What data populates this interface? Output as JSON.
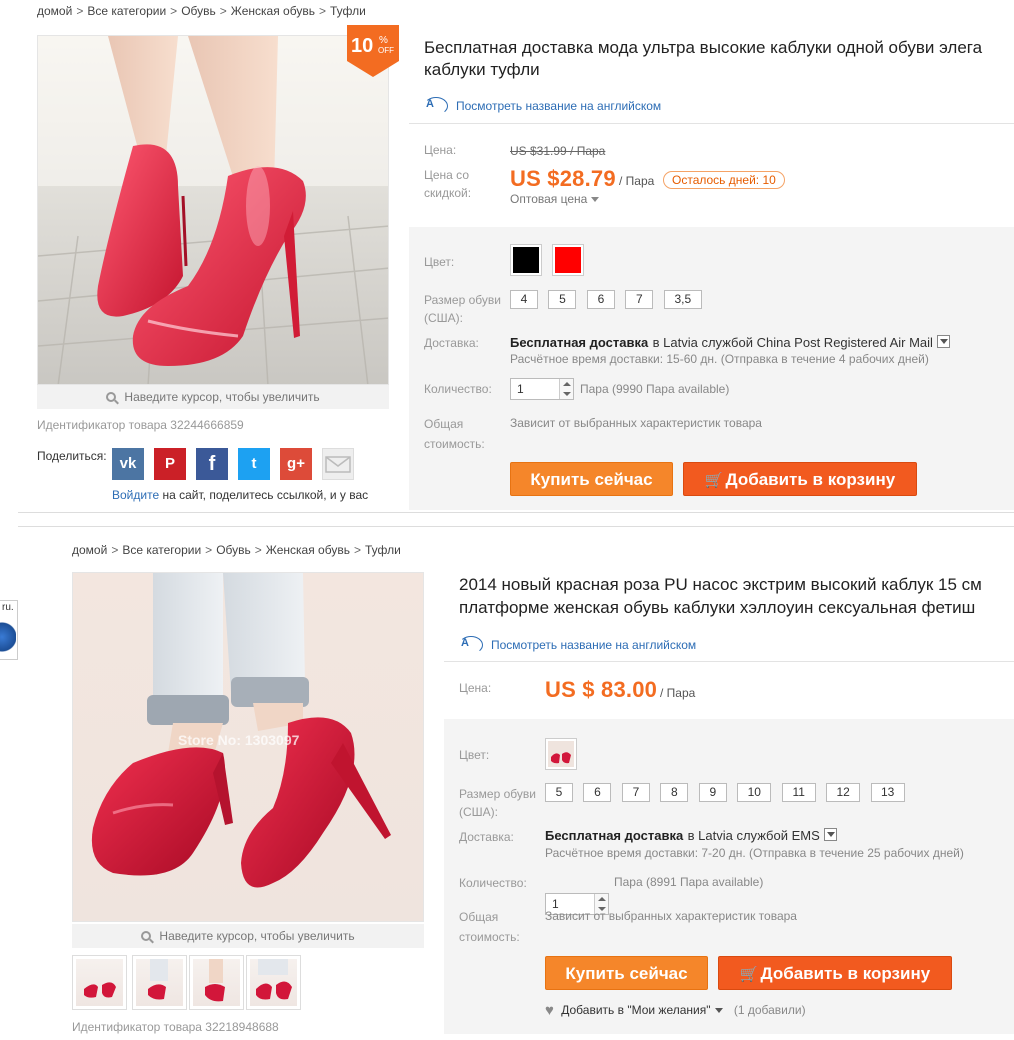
{
  "top": {
    "breadcrumb": [
      "домой",
      "Все категории",
      "Обувь",
      "Женская обувь",
      "Туфли"
    ],
    "sale_badge": {
      "percent": "10",
      "sign": "%",
      "off": "OFF"
    },
    "title_line1": "Бесплатная доставка мода ультра высокие каблуки одной обуви элега",
    "title_line2": "каблуки туфли",
    "translate_label": "Посмотреть название на английском",
    "price_label": "Цена:",
    "old_price": "US $31.99 / Пара",
    "discount_label": "Цена со скидкой:",
    "price": "US $28.79",
    "unit": "/ Пара",
    "days_left": "Осталось дней: 10",
    "wholesale": "Оптовая цена",
    "color_label": "Цвет:",
    "colors": [
      "#000000",
      "#ff0000"
    ],
    "size_label": "Размер обуви (США):",
    "sizes": [
      "4",
      "5",
      "6",
      "7",
      "3,5"
    ],
    "shipping_label": "Доставка:",
    "shipping_free": "Бесплатная доставка",
    "shipping_rest": "в Latvia службой China Post Registered Air Mail",
    "shipping_sub": "Расчётное время доставки: 15-60 дн. (Отправка в течение 4 рабочих дней)",
    "qty_label": "Количество:",
    "qty_value": "1",
    "qty_available": "Пара (9990 Пара available)",
    "total_label": "Общая стоимость:",
    "total_value": "Зависит от выбранных характеристик товара",
    "buy_now": "Купить сейчас",
    "add_to_cart": "Добавить в корзину",
    "zoom_hint": "Наведите курсор, чтобы увеличить",
    "product_id": "Идентификатор товара 32244666859",
    "share_label": "Поделиться:",
    "share_login_link": "Войдите",
    "share_login_rest": "на сайт, поделитесь ссылкой, и у вас",
    "share_icons": [
      "vk",
      "pinterest",
      "facebook",
      "twitter",
      "google-plus",
      "email"
    ]
  },
  "bottom": {
    "breadcrumb": [
      "домой",
      "Все категории",
      "Обувь",
      "Женская обувь",
      "Туфли"
    ],
    "title_line1": "2014 новый красная роза PU насос экстрим высокий каблук 15 см",
    "title_line2": "платформе женская обувь каблуки хэллоуин сексуальная фетиш",
    "translate_label": "Посмотреть название на английском",
    "price_label": "Цена:",
    "price": "US $ 83.00",
    "unit": "/ Пара",
    "color_label": "Цвет:",
    "size_label": "Размер обуви (США):",
    "sizes": [
      "5",
      "6",
      "7",
      "8",
      "9",
      "10",
      "11",
      "12",
      "13"
    ],
    "shipping_label": "Доставка:",
    "shipping_free": "Бесплатная доставка",
    "shipping_rest": "в Latvia службой EMS",
    "shipping_sub": "Расчётное время доставки: 7-20 дн. (Отправка в течение 25 рабочих дней)",
    "qty_label": "Количество:",
    "qty_value": "1",
    "qty_available": "Пара (8991 Пара available)",
    "total_label": "Общая стоимость:",
    "total_value": "Зависит от выбранных характеристик товара",
    "buy_now": "Купить сейчас",
    "add_to_cart": "Добавить в корзину",
    "wishlist": "Добавить в \"Мои желания\"",
    "wishlist_count": "(1 добавили)",
    "zoom_hint": "Наведите курсор, чтобы увеличить",
    "watermark": "Store No: 1303097",
    "product_id": "Идентификатор товара 32218948688"
  },
  "side_widget": {
    "label": "ru."
  }
}
